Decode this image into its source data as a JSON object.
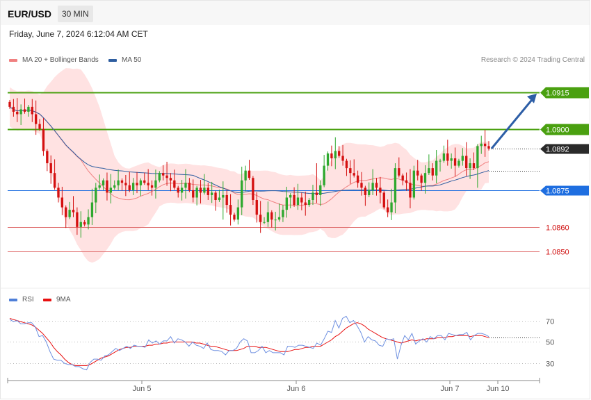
{
  "header": {
    "symbol": "EUR/USD",
    "timeframe": "30 MIN",
    "datetime": "Friday, June 7, 2024 6:12:04 AM CET",
    "credit": "Research © 2024 Trading Central"
  },
  "legend": {
    "price": [
      {
        "label": "MA 20 + Bollinger Bands",
        "color": "#f08080"
      },
      {
        "label": "MA 50",
        "color": "#2f5ea0"
      }
    ],
    "rsi": [
      {
        "label": "RSI",
        "color": "#4f7fd8"
      },
      {
        "label": "9MA",
        "color": "#e81010"
      }
    ]
  },
  "colors": {
    "up_candle": "#2ea82e",
    "down_candle": "#d41010",
    "resistance": "#4aa010",
    "support": "#1e6ee0",
    "minor": "#e07070",
    "current": "#2a2a2a",
    "arrow": "#2d5ea6",
    "band_fill": "#ffd8d8"
  },
  "chart_data": [
    {
      "type": "candlestick",
      "title": "EUR/USD 30 MIN",
      "ylim": [
        1.0837,
        1.0922
      ],
      "x_ticks": [
        "Jun 5",
        "Jun 6",
        "Jun 7",
        "Jun 10"
      ],
      "levels": [
        {
          "value": 1.0915,
          "label": "1.0915",
          "kind": "resistance"
        },
        {
          "value": 1.09,
          "label": "1.0900",
          "kind": "resistance"
        },
        {
          "value": 1.0892,
          "label": "1.0892",
          "kind": "current"
        },
        {
          "value": 1.0875,
          "label": "1.0875",
          "kind": "support"
        },
        {
          "value": 1.086,
          "label": "1.0860",
          "kind": "minor"
        },
        {
          "value": 1.085,
          "label": "1.0850",
          "kind": "minor"
        }
      ],
      "projection": {
        "from": 1.0892,
        "to": 1.0915
      },
      "ma50_end": 1.0883,
      "series": [
        {
          "name": "price",
          "close": [
            1.0909,
            1.0907,
            1.0906,
            1.0908,
            1.0907,
            1.0909,
            1.0906,
            1.0902,
            1.09,
            1.0891,
            1.0886,
            1.0882,
            1.0876,
            1.0872,
            1.0868,
            1.0864,
            1.0867,
            1.0866,
            1.086,
            1.0862,
            1.0861,
            1.0864,
            1.087,
            1.0876,
            1.0877,
            1.0879,
            1.0874,
            1.0876,
            1.0877,
            1.0879,
            1.0878,
            1.0877,
            1.0875,
            1.0878,
            1.0877,
            1.0879,
            1.0878,
            1.0877,
            1.0876,
            1.0879,
            1.0882,
            1.0881,
            1.088,
            1.0879,
            1.0876,
            1.0874,
            1.0876,
            1.0878,
            1.0875,
            1.0872,
            1.0876,
            1.0874,
            1.0876,
            1.0873,
            1.0874,
            1.0871,
            1.0872,
            1.0873,
            1.0869,
            1.0865,
            1.0863,
            1.0868,
            1.0879,
            1.0883,
            1.088,
            1.0871,
            1.0865,
            1.0862,
            1.0862,
            1.0866,
            1.0863,
            1.0863,
            1.0864,
            1.0867,
            1.0872,
            1.0873,
            1.0869,
            1.0872,
            1.087,
            1.0869,
            1.0871,
            1.0874,
            1.0873,
            1.0877,
            1.0885,
            1.089,
            1.0888,
            1.0891,
            1.0889,
            1.0887,
            1.0884,
            1.0882,
            1.0881,
            1.0878,
            1.0876,
            1.0873,
            1.0875,
            1.0878,
            1.0876,
            1.0874,
            1.0868,
            1.0866,
            1.087,
            1.0884,
            1.0881,
            1.0879,
            1.0878,
            1.0872,
            1.0883,
            1.0881,
            1.0878,
            1.0882,
            1.0884,
            1.0881,
            1.0887,
            1.0887,
            1.089,
            1.0887,
            1.0888,
            1.0885,
            1.0887,
            1.0889,
            1.0884,
            1.0886,
            1.0884,
            1.0893,
            1.0894,
            1.0893,
            1.0892
          ]
        }
      ]
    },
    {
      "type": "line",
      "title": "RSI",
      "ylim": [
        14,
        84
      ],
      "y_ticks": [
        70,
        50,
        30
      ],
      "series": [
        {
          "name": "RSI",
          "values": [
            71,
            69,
            70,
            67,
            67,
            68,
            68,
            64,
            55,
            56,
            50,
            41,
            34,
            33,
            33,
            30,
            29,
            29,
            27,
            27,
            25,
            24,
            31,
            34,
            34,
            33,
            37,
            38,
            41,
            44,
            42,
            44,
            46,
            44,
            47,
            46,
            46,
            45,
            52,
            49,
            51,
            48,
            51,
            51,
            55,
            49,
            53,
            52,
            50,
            46,
            50,
            47,
            46,
            44,
            49,
            43,
            42,
            42,
            41,
            38,
            42,
            42,
            44,
            50,
            53,
            51,
            40,
            40,
            42,
            46,
            40,
            42,
            40,
            40,
            40,
            38,
            46,
            46,
            45,
            47,
            47,
            46,
            45,
            44,
            49,
            47,
            53,
            60,
            59,
            70,
            63,
            72,
            74,
            68,
            70,
            65,
            59,
            50,
            55,
            52,
            51,
            47,
            46,
            53,
            52,
            53,
            34,
            47,
            56,
            52,
            58,
            48,
            51,
            53,
            50,
            55,
            53,
            56,
            56,
            52,
            58,
            57,
            56,
            57,
            57,
            59,
            52,
            56,
            58,
            58,
            57,
            55
          ]
        },
        {
          "name": "9MA",
          "values": [
            72,
            71,
            70,
            69,
            68,
            67,
            66,
            64,
            61,
            58,
            54,
            50,
            45,
            41,
            38,
            34,
            31,
            29,
            28,
            28,
            28,
            28,
            29,
            31,
            33,
            35,
            36,
            37,
            39,
            41,
            43,
            44,
            45,
            45,
            46,
            46,
            46,
            46,
            47,
            47,
            48,
            48,
            49,
            49,
            50,
            50,
            50,
            50,
            50,
            50,
            50,
            49,
            49,
            48,
            47,
            46,
            46,
            45,
            44,
            43,
            42,
            42,
            42,
            43,
            44,
            46,
            46,
            46,
            45,
            45,
            45,
            44,
            43,
            42,
            41,
            41,
            41,
            42,
            43,
            43,
            44,
            45,
            45,
            46,
            46,
            46,
            48,
            50,
            52,
            55,
            57,
            60,
            63,
            65,
            67,
            68,
            67,
            65,
            62,
            60,
            58,
            56,
            54,
            53,
            52,
            51,
            50,
            49,
            50,
            51,
            52,
            51,
            52,
            52,
            53,
            53,
            53,
            54,
            54,
            54,
            55,
            55,
            56,
            56,
            56,
            56,
            55,
            56,
            56,
            56,
            55,
            54
          ]
        }
      ]
    }
  ]
}
